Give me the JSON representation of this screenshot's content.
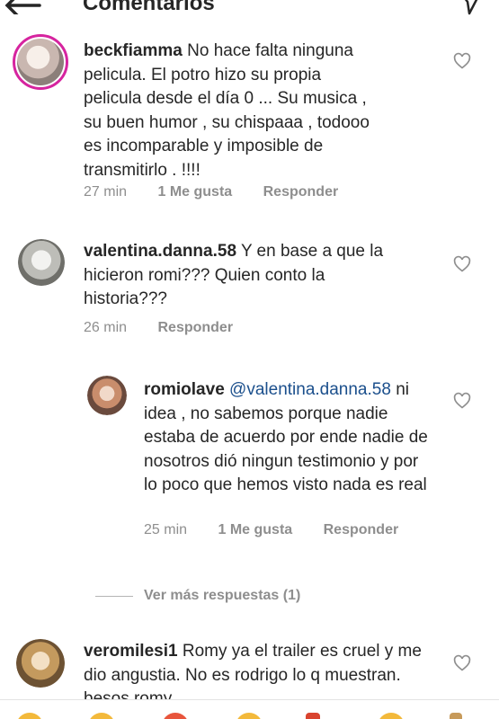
{
  "header": {
    "title": "Comentarios",
    "back_icon": "back-arrow-icon",
    "send_icon": "send-icon"
  },
  "comments": [
    {
      "username": "beckfiamma",
      "text": "No hace falta ninguna pelicula. El potro hizo su propia pelicula desde el día 0 ... Su musica , su buen humor , su chispaaa , todooo es incomparable y imposible de transmitirlo . !!!!",
      "time": "27 min",
      "likes": "1 Me gusta",
      "reply": "Responder"
    },
    {
      "username": "valentina.danna.58",
      "text": "Y en base a que la hicieron romi??? Quien conto la historia???",
      "time": "26 min",
      "reply": "Responder"
    },
    {
      "username": "romiolave",
      "mention": "@valentina.danna.58",
      "text": "ni idea , no sabemos porque nadie estaba de acuerdo por ende nadie de nosotros dió ningun testimonio y por lo poco que hemos visto nada es real",
      "time": "25 min",
      "likes": "1 Me gusta",
      "reply": "Responder"
    },
    {
      "username": "veromilesi1",
      "text": "Romy ya el trailer es cruel y me dio angustia. No es rodrigo lo q muestran. besos romy"
    }
  ],
  "more_replies": "Ver más respuestas (1)",
  "colors": {
    "text": "#262626",
    "meta": "#8e8e8e",
    "mention": "#1b4f8c",
    "story_ring": "#d6249f"
  }
}
